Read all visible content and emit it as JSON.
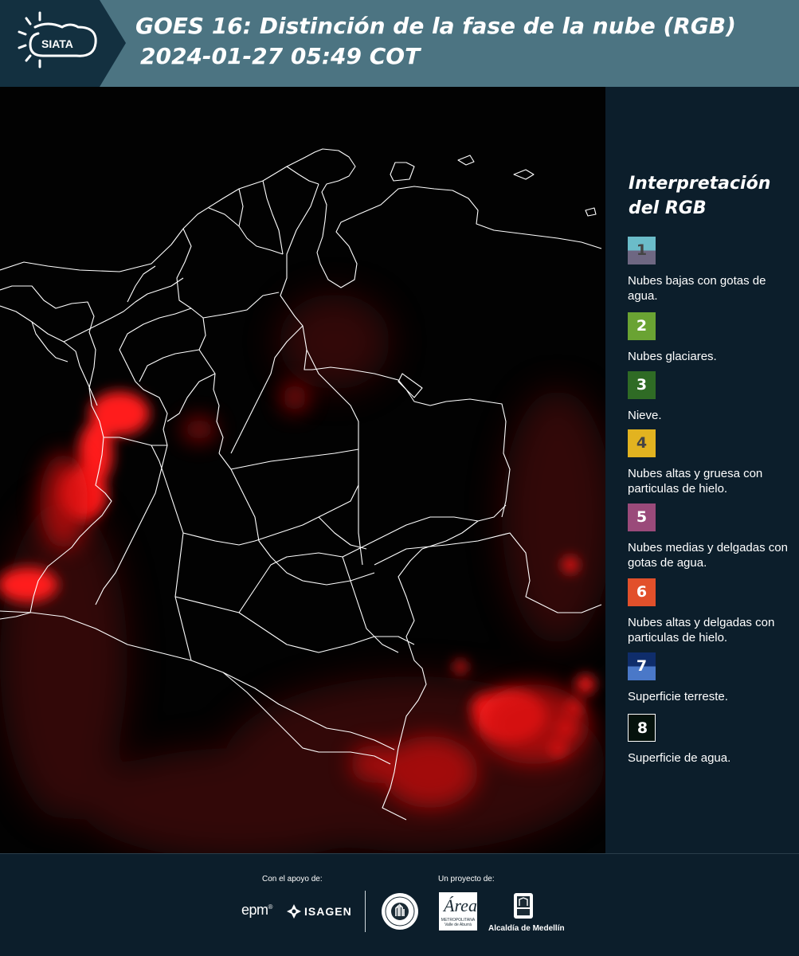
{
  "header": {
    "logo_text": "SIATA",
    "title_line1": "GOES 16: Distinción de la fase de la nube (RGB)",
    "title_line2": "2024-01-27 05:49 COT"
  },
  "legend": {
    "title_line1": "Interpretación",
    "title_line2": "del RGB",
    "items": [
      {
        "number": "1",
        "label": "Nubes bajas con gotas de agua.",
        "color_top": "#6bbcc9",
        "color_bottom": "#6e6782",
        "num_color": "#444444"
      },
      {
        "number": "2",
        "label": "Nubes glaciares.",
        "color_top": "#6aa333",
        "color_bottom": "#6aa333",
        "num_color": "#ffffff"
      },
      {
        "number": "3",
        "label": "Nieve.",
        "color_top": "#2f6b25",
        "color_bottom": "#2f6b25",
        "num_color": "#ffffff"
      },
      {
        "number": "4",
        "label": "Nubes altas y gruesa con particulas de hielo.",
        "color_top": "#e2b320",
        "color_bottom": "#e2b320",
        "num_color": "#444444"
      },
      {
        "number": "5",
        "label": "Nubes medias y delgadas con gotas de agua.",
        "color_top": "#9a4a7a",
        "color_bottom": "#9a4a7a",
        "num_color": "#ffffff"
      },
      {
        "number": "6",
        "label": "Nubes altas y delgadas con particulas de hielo.",
        "color_top": "#e2502b",
        "color_bottom": "#e2502b",
        "num_color": "#ffffff"
      },
      {
        "number": "7",
        "label": "Superficie terreste.",
        "color_top": "#0f2d6b",
        "color_bottom": "#4a78c8",
        "num_color": "#ffffff"
      },
      {
        "number": "8",
        "label": "Superficie de agua.",
        "color_top": "#05120c",
        "color_bottom": "#05120c",
        "num_color": "#ffffff"
      }
    ]
  },
  "footer": {
    "support_label": "Con el apoyo de:",
    "project_label": "Un proyecto de:",
    "epm_text": "epm",
    "isagen_text": "ISAGEN",
    "area_text": "Área",
    "area_sub": "METROPOLITANA Valle de Aburrá",
    "medellin_text": "Alcaldía de Medellín"
  },
  "colors": {
    "header_bg": "#4c7482",
    "page_bg": "#0c1e2b",
    "cloud_red": "#ff2020",
    "borders": "#ffffff"
  }
}
